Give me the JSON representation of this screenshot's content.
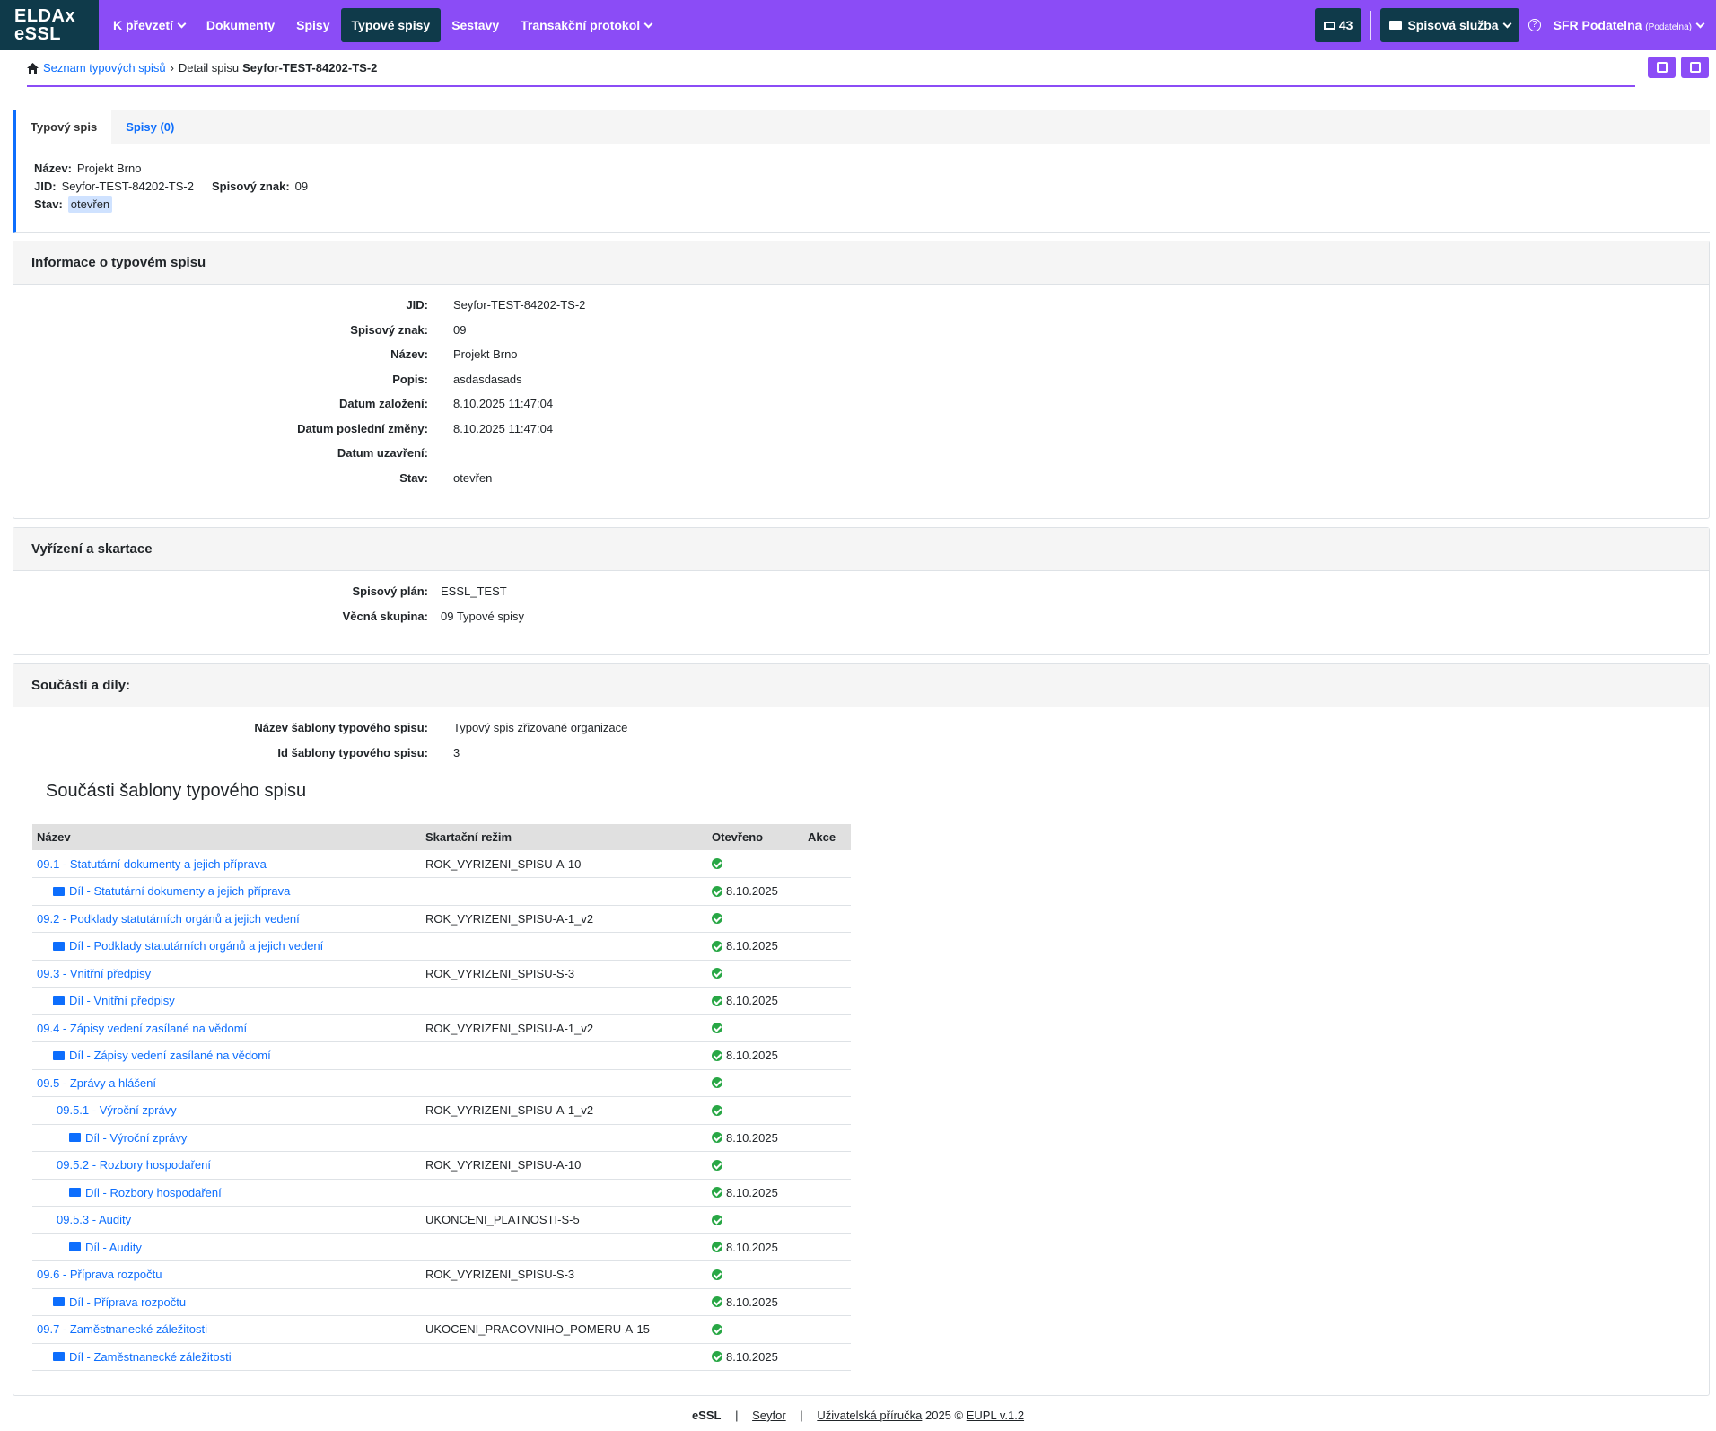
{
  "nav": {
    "logo_line1": "ELDAx",
    "logo_line2": "eSSL",
    "items": [
      {
        "label": "K převzetí",
        "dropdown": true
      },
      {
        "label": "Dokumenty"
      },
      {
        "label": "Spisy"
      },
      {
        "label": "Typové spisy",
        "active": true
      },
      {
        "label": "Sestavy"
      },
      {
        "label": "Transakční protokol",
        "dropdown": true
      }
    ],
    "messages_count": "43",
    "service_label": "Spisová služba",
    "help_icon": "?",
    "user_name": "SFR Podatelna",
    "user_role": "(Podatelna)"
  },
  "breadcrumb": {
    "list_link": "Seznam typových spisů",
    "detail_prefix": "Detail spisu",
    "current": "Seyfor-TEST-84202-TS-2"
  },
  "tabs": {
    "active": "Typový spis",
    "other": "Spisy (0)"
  },
  "summary": {
    "name_label": "Název:",
    "name_value": "Projekt Brno",
    "jid_label": "JID:",
    "jid_value": "Seyfor-TEST-84202-TS-2",
    "sign_label": "Spisový znak:",
    "sign_value": "09",
    "state_label": "Stav:",
    "state_value": "otevřen"
  },
  "info": {
    "title": "Informace o typovém spisu",
    "rows": [
      {
        "label": "JID:",
        "value": "Seyfor-TEST-84202-TS-2"
      },
      {
        "label": "Spisový znak:",
        "value": "09"
      },
      {
        "label": "Název:",
        "value": "Projekt Brno"
      },
      {
        "label": "Popis:",
        "value": "asdasdasads"
      },
      {
        "label": "Datum založení:",
        "value": "8.10.2025 11:47:04"
      },
      {
        "label": "Datum poslední změny:",
        "value": "8.10.2025 11:47:04"
      },
      {
        "label": "Datum uzavření:",
        "value": ""
      },
      {
        "label": "Stav:",
        "value": "otevřen"
      }
    ]
  },
  "disposal": {
    "title": "Vyřízení a skartace",
    "rows": [
      {
        "label": "Spisový plán:",
        "value": "ESSL_TEST"
      },
      {
        "label": "Věcná skupina:",
        "value": "09 Typové spisy"
      }
    ]
  },
  "parts": {
    "title": "Součásti a díly:",
    "rows": [
      {
        "label": "Název šablony typového spisu:",
        "value": "Typový spis zřizované organizace"
      },
      {
        "label": "Id šablony typového spisu:",
        "value": "3"
      }
    ],
    "table_title": "Součásti šablony typového spisu",
    "columns": [
      "Název",
      "Skartační režim",
      "Otevřeno",
      "Akce"
    ],
    "items": [
      {
        "name": "09.1 - Statutární dokumenty a jejich příprava",
        "regime": "ROK_VYRIZENI_SPISU-A-10",
        "opened": "",
        "level": 0,
        "folder": false
      },
      {
        "name": "Díl - Statutární dokumenty a jejich příprava",
        "regime": "",
        "opened": "8.10.2025",
        "level": 1,
        "folder": true
      },
      {
        "name": "09.2 - Podklady statutárních orgánů a jejich vedení",
        "regime": "ROK_VYRIZENI_SPISU-A-1_v2",
        "opened": "",
        "level": 0,
        "folder": false
      },
      {
        "name": "Díl - Podklady statutárních orgánů a jejich vedení",
        "regime": "",
        "opened": "8.10.2025",
        "level": 1,
        "folder": true
      },
      {
        "name": "09.3 - Vnitřní předpisy",
        "regime": "ROK_VYRIZENI_SPISU-S-3",
        "opened": "",
        "level": 0,
        "folder": false
      },
      {
        "name": "Díl - Vnitřní předpisy",
        "regime": "",
        "opened": "8.10.2025",
        "level": 1,
        "folder": true
      },
      {
        "name": "09.4 - Zápisy vedení zasílané na vědomí",
        "regime": "ROK_VYRIZENI_SPISU-A-1_v2",
        "opened": "",
        "level": 0,
        "folder": false
      },
      {
        "name": "Díl - Zápisy vedení zasílané na vědomí",
        "regime": "",
        "opened": "8.10.2025",
        "level": 1,
        "folder": true
      },
      {
        "name": "09.5 - Zprávy a hlášení",
        "regime": "",
        "opened": "",
        "level": 0,
        "folder": false
      },
      {
        "name": "09.5.1 - Výroční zprávy",
        "regime": "ROK_VYRIZENI_SPISU-A-1_v2",
        "opened": "",
        "level": 1,
        "folder": false
      },
      {
        "name": "Díl - Výroční zprávy",
        "regime": "",
        "opened": "8.10.2025",
        "level": 2,
        "folder": true
      },
      {
        "name": "09.5.2 - Rozbory hospodaření",
        "regime": "ROK_VYRIZENI_SPISU-A-10",
        "opened": "",
        "level": 1,
        "folder": false
      },
      {
        "name": "Díl - Rozbory hospodaření",
        "regime": "",
        "opened": "8.10.2025",
        "level": 2,
        "folder": true
      },
      {
        "name": "09.5.3 - Audity",
        "regime": "UKONCENI_PLATNOSTI-S-5",
        "opened": "",
        "level": 1,
        "folder": false
      },
      {
        "name": "Díl - Audity",
        "regime": "",
        "opened": "8.10.2025",
        "level": 2,
        "folder": true
      },
      {
        "name": "09.6 - Příprava rozpočtu",
        "regime": "ROK_VYRIZENI_SPISU-S-3",
        "opened": "",
        "level": 0,
        "folder": false
      },
      {
        "name": "Díl - Příprava rozpočtu",
        "regime": "",
        "opened": "8.10.2025",
        "level": 1,
        "folder": true
      },
      {
        "name": "09.7 - Zaměstnanecké záležitosti",
        "regime": "UKOCENI_PRACOVNIHO_POMERU-A-15",
        "opened": "",
        "level": 0,
        "folder": false
      },
      {
        "name": "Díl - Zaměstnanecké záležitosti",
        "regime": "",
        "opened": "8.10.2025",
        "level": 1,
        "folder": true
      }
    ]
  },
  "footer": {
    "brand": "eSSL",
    "company": "Seyfor",
    "manual": "Uživatelská příručka",
    "year": "2025 ©",
    "license": "EUPL v.1.2"
  }
}
